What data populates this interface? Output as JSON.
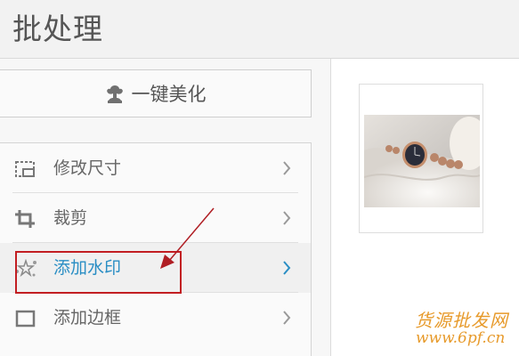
{
  "header": {
    "title": "批处理"
  },
  "beautify": {
    "label": "一键美化",
    "icon": "flower-icon"
  },
  "menu": {
    "items": [
      {
        "label": "修改尺寸",
        "icon": "resize-icon",
        "active": false
      },
      {
        "label": "裁剪",
        "icon": "crop-icon",
        "active": false
      },
      {
        "label": "添加水印",
        "icon": "watermark-icon",
        "active": true
      },
      {
        "label": "添加边框",
        "icon": "frame-icon",
        "active": false
      }
    ]
  },
  "preview": {
    "image": "watch-photo-thumbnail"
  },
  "watermark": {
    "line1": "货源批发网",
    "line2": "www.6pf.cn"
  },
  "colors": {
    "active_text": "#2a8ec4",
    "highlight": "#c21e22",
    "watermark": "#e79a2b"
  }
}
